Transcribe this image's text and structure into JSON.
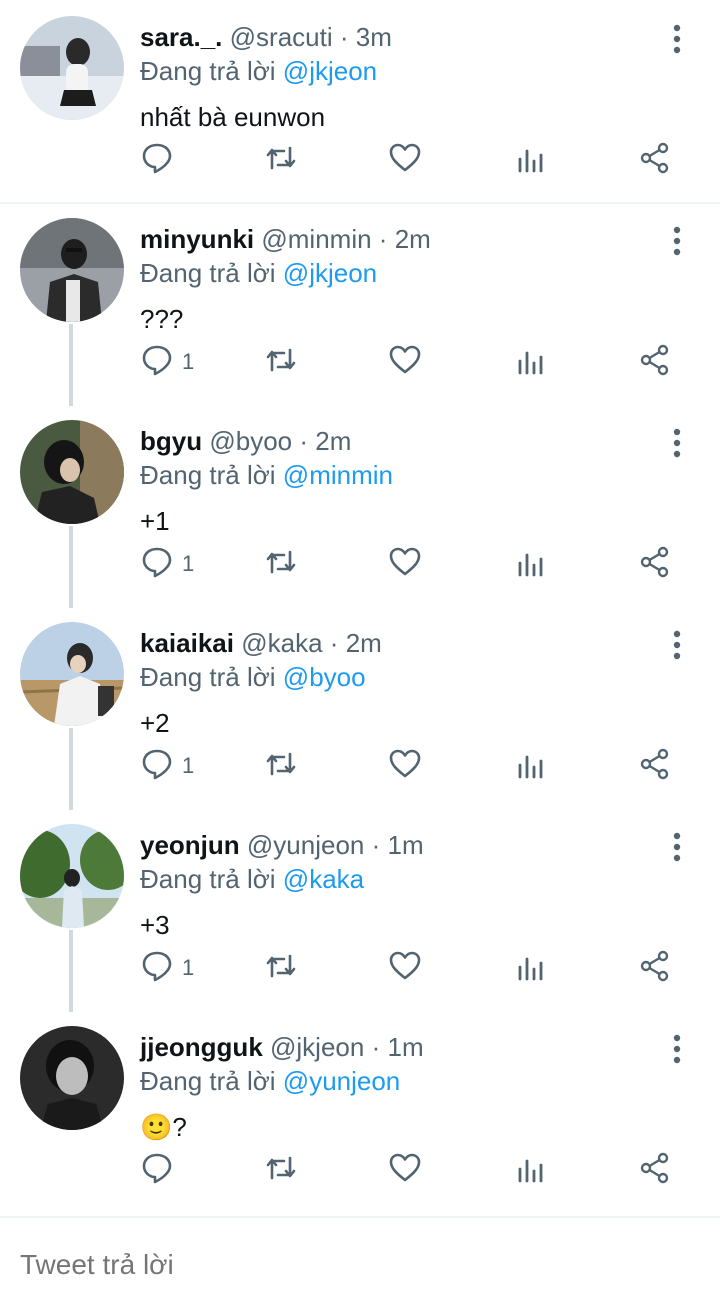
{
  "reply_prefix": "Đang trả lời",
  "compose": {
    "placeholder": "Tweet trả lời"
  },
  "colors": {
    "accent": "#1d9bf0",
    "secondary_text": "#536471",
    "thread_line": "#cfd9de"
  },
  "tweets": [
    {
      "name": "sara._.",
      "handle": "@sracuti",
      "separator": "·",
      "time": "3m",
      "reply_to": "@jkjeon",
      "text": "nhất bà eunwon",
      "reply_count": ""
    },
    {
      "name": "minyunki",
      "handle": "@minmin",
      "separator": "·",
      "time": "2m",
      "reply_to": "@jkjeon",
      "text": "???",
      "reply_count": "1"
    },
    {
      "name": "bgyu",
      "handle": "@byoo",
      "separator": "·",
      "time": "2m",
      "reply_to": "@minmin",
      "text": "+1",
      "reply_count": "1"
    },
    {
      "name": "kaiaikai",
      "handle": "@kaka",
      "separator": "·",
      "time": "2m",
      "reply_to": "@byoo",
      "text": "+2",
      "reply_count": "1"
    },
    {
      "name": "yeonjun",
      "handle": "@yunjeon",
      "separator": "·",
      "time": "1m",
      "reply_to": "@kaka",
      "text": "+3",
      "reply_count": "1"
    },
    {
      "name": "jjeongguk",
      "handle": "@jkjeon",
      "separator": "·",
      "time": "1m",
      "reply_to": "@yunjeon",
      "text": "🙂?",
      "reply_count": ""
    }
  ]
}
